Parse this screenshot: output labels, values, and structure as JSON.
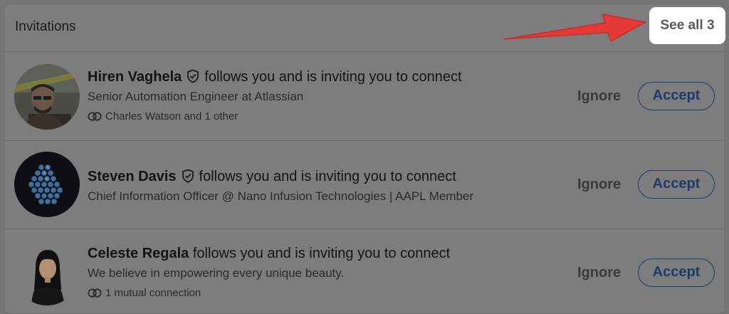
{
  "section": {
    "title": "Invitations",
    "see_all_label": "See all 3"
  },
  "invitations": [
    {
      "name": "Hiren Vaghela",
      "verified": true,
      "action_text": "follows you and is inviting you to connect",
      "headline": "Senior Automation Engineer at Atlassian",
      "mutual": "Charles Watson and 1 other",
      "ignore_label": "Ignore",
      "accept_label": "Accept"
    },
    {
      "name": "Steven Davis",
      "verified": true,
      "action_text": "follows you and is inviting you to connect",
      "headline": "Chief Information Officer @ Nano Infusion Technologies | AAPL Member",
      "mutual": "",
      "ignore_label": "Ignore",
      "accept_label": "Accept"
    },
    {
      "name": "Celeste Regala",
      "verified": false,
      "action_text": "follows you and is inviting you to connect",
      "headline": "We believe in empowering every unique beauty.",
      "mutual": "1 mutual connection",
      "ignore_label": "Ignore",
      "accept_label": "Accept"
    }
  ],
  "icons": {
    "verified": "shield-check-icon",
    "mutual": "mutual-connections-icon",
    "annotation": "red-arrow"
  },
  "colors": {
    "accept": "#1e3c6a",
    "annotation_arrow": "#e53935",
    "highlight": "#ffffff"
  }
}
